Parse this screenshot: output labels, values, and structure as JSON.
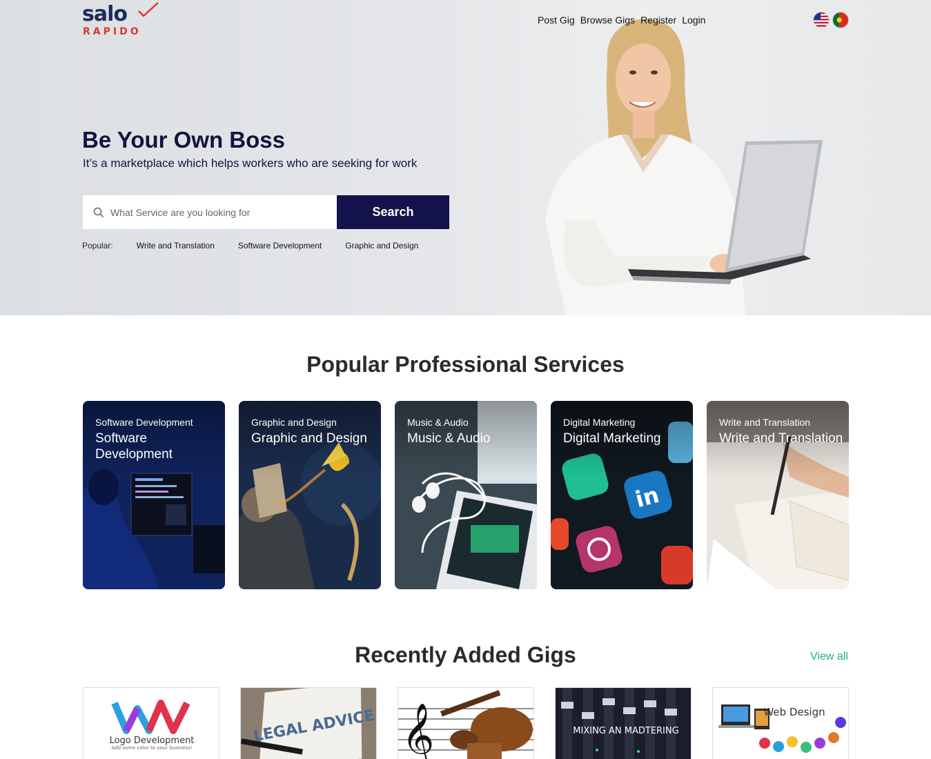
{
  "brand": {
    "name_top": "salo",
    "name_bottom": "RAPIDO"
  },
  "nav": [
    {
      "label": "Post Gig"
    },
    {
      "label": "Browse Gigs"
    },
    {
      "label": "Register"
    },
    {
      "label": "Login"
    }
  ],
  "languages": [
    "English (US flag)",
    "Portuguese (Portugal flag)"
  ],
  "hero": {
    "title": "Be Your Own Boss",
    "subtitle": "It’s a marketplace which helps workers who are seeking for work",
    "search_placeholder": "What Service are you looking for",
    "search_button": "Search",
    "popular_label": "Popular:",
    "popular_links": [
      "Write and Translation",
      "Software Development",
      "Graphic and Design"
    ]
  },
  "services": {
    "title": "Popular Professional Services",
    "cards": [
      {
        "small": "Software Development",
        "big": "Software Development"
      },
      {
        "small": "Graphic and Design",
        "big": "Graphic and Design"
      },
      {
        "small": "Music & Audio",
        "big": "Music & Audio"
      },
      {
        "small": "Digital Marketing",
        "big": "Digital Marketing"
      },
      {
        "small": "Write and Translation",
        "big": "Write and Translation"
      }
    ]
  },
  "gigs": {
    "title": "Recently Added Gigs",
    "view_all": "View all",
    "items": [
      {
        "image_text": "Logo Development",
        "image_subtext": "Add some color to your business!"
      },
      {
        "image_text": "LEGAL ADVICE"
      },
      {
        "image_text": ""
      },
      {
        "image_text": "MIXING AN MADTERING"
      },
      {
        "image_text": "Web Design"
      }
    ]
  },
  "colors": {
    "navy": "#13124a",
    "title_navy": "#14123d",
    "accent_green": "#1cae73",
    "brand_red": "#d63a2f"
  }
}
